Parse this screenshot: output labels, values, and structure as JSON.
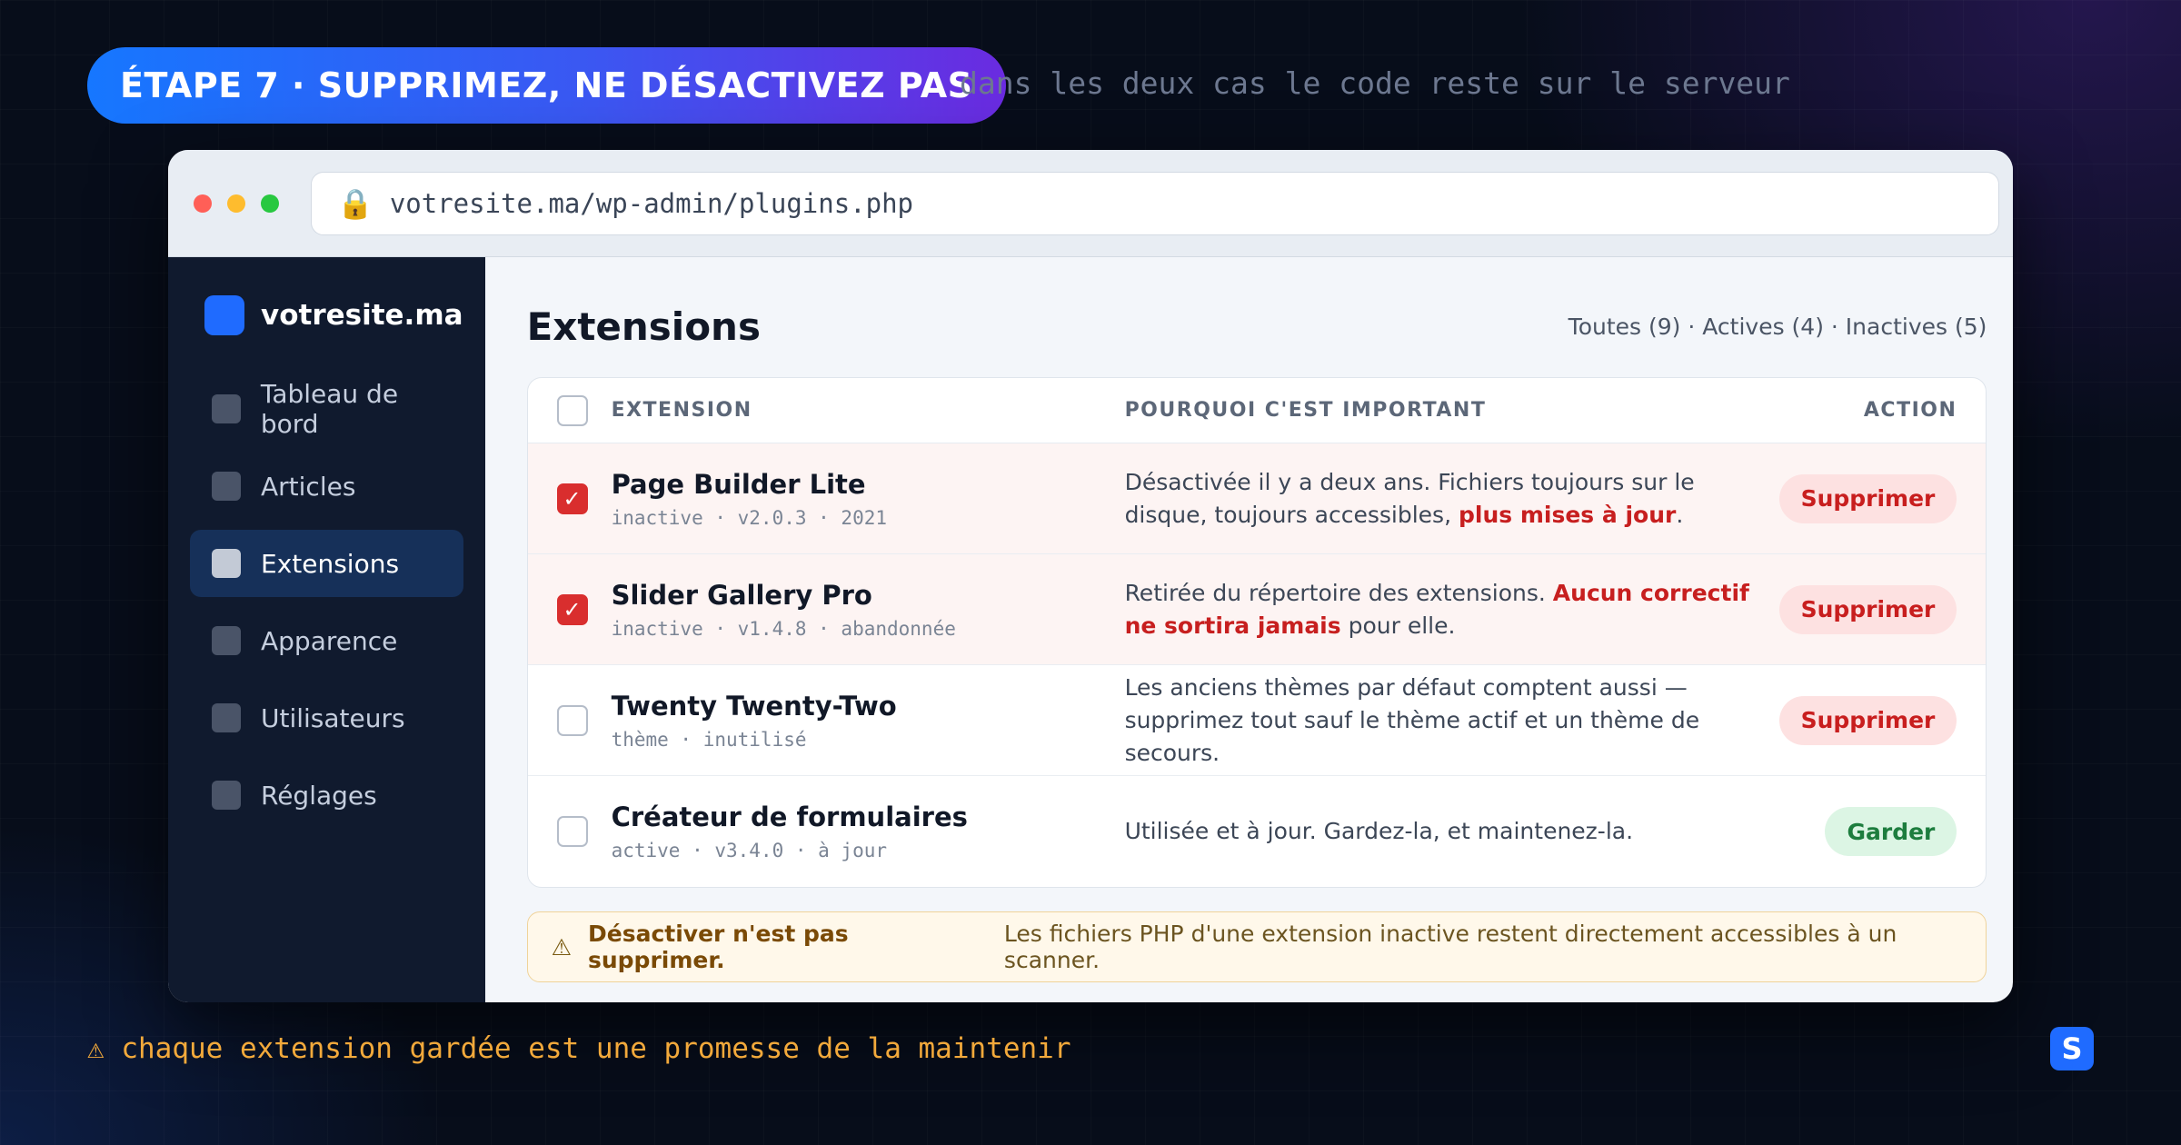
{
  "header": {
    "step": "ÉTAPE 7 · SUPPRIMEZ, NE DÉSACTIVEZ PAS",
    "subtitle": "dans les deux cas le code reste sur le serveur"
  },
  "browser": {
    "url": "votresite.ma/wp-admin/plugins.php",
    "lock_icon": "🔒"
  },
  "sidebar": {
    "site_name": "votresite.ma",
    "items": [
      {
        "label": "Tableau de bord"
      },
      {
        "label": "Articles"
      },
      {
        "label": "Extensions"
      },
      {
        "label": "Apparence"
      },
      {
        "label": "Utilisateurs"
      },
      {
        "label": "Réglages"
      }
    ]
  },
  "main": {
    "title": "Extensions",
    "filters": "Toutes (9) · Actives (4) · Inactives (5)",
    "columns": {
      "extension": "EXTENSION",
      "why": "POURQUOI C'EST IMPORTANT",
      "action": "ACTION"
    },
    "rows": [
      {
        "name": "Page Builder Lite",
        "meta": "inactive · v2.0.3 · 2021",
        "checked": true,
        "why_a": "Désactivée il y a deux ans. Fichiers toujours sur le disque, toujours accessibles, ",
        "why_hl": "plus mises à jour",
        "why_b": ".",
        "action": "Supprimer"
      },
      {
        "name": "Slider Gallery Pro",
        "meta": "inactive · v1.4.8 · abandonnée",
        "checked": true,
        "why_a": "Retirée du répertoire des extensions. ",
        "why_hl": "Aucun correctif ne sortira jamais",
        "why_b": " pour elle.",
        "action": "Supprimer"
      },
      {
        "name": "Twenty Twenty-Two",
        "meta": "thème · inutilisé",
        "checked": false,
        "why_a": "Les anciens thèmes par défaut comptent aussi — supprimez tout sauf le thème actif et un thème de secours.",
        "why_hl": "",
        "why_b": "",
        "action": "Supprimer"
      },
      {
        "name": "Créateur de formulaires",
        "meta": "active · v3.4.0 · à jour",
        "checked": false,
        "why_a": "Utilisée et à jour. Gardez-la, et maintenez-la.",
        "why_hl": "",
        "why_b": "",
        "action": "Garder"
      }
    ],
    "warning": {
      "icon": "⚠",
      "bold": "Désactiver n'est pas supprimer.",
      "text": "Les fichiers PHP d'une extension inactive restent directement accessibles à un scanner."
    }
  },
  "footer": {
    "note": "⚠ chaque extension gardée est une promesse de la maintenir",
    "logo_letter": "S"
  },
  "colors": {
    "accent": "#1f6bff",
    "danger": "#c81e1e",
    "success": "#1d7d3e",
    "warning": "#f2a93b"
  }
}
